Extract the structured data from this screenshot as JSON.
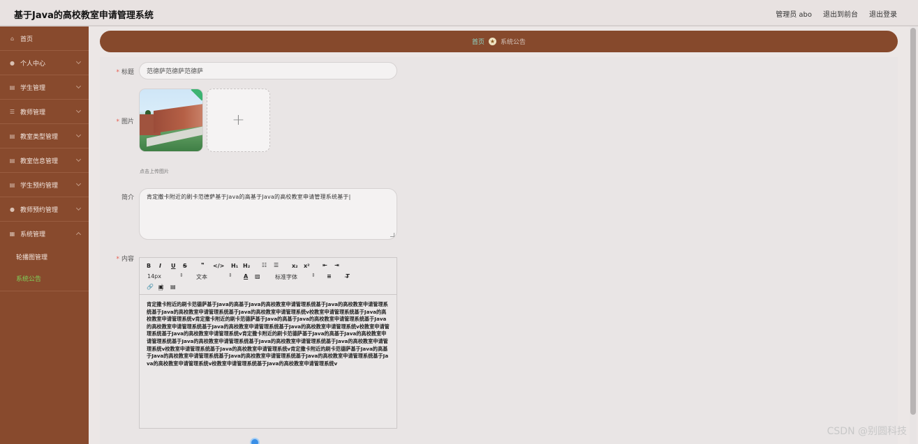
{
  "header": {
    "title": "基于Java的高校教室申请管理系统",
    "user": "管理员 abo",
    "front_link": "退出到前台",
    "logout": "退出登录"
  },
  "sidebar": {
    "items": [
      {
        "label": "首页",
        "icon": "home-icon"
      },
      {
        "label": "个人中心",
        "icon": "user-icon"
      },
      {
        "label": "学生管理",
        "icon": "doc-icon"
      },
      {
        "label": "教师管理",
        "icon": "list-icon"
      },
      {
        "label": "教室类型管理",
        "icon": "doc-icon"
      },
      {
        "label": "教室信息管理",
        "icon": "doc-icon"
      },
      {
        "label": "学生预约管理",
        "icon": "doc-icon"
      },
      {
        "label": "教师预约管理",
        "icon": "user-icon"
      },
      {
        "label": "系统管理",
        "icon": "grid-icon"
      }
    ],
    "sub_items": [
      {
        "label": "轮播图管理",
        "active": false
      },
      {
        "label": "系统公告",
        "active": true
      }
    ],
    "active_color": "#7fd35a"
  },
  "breadcrumb": {
    "home": "首页",
    "current": "系统公告"
  },
  "form": {
    "title_label": "标题",
    "title_value": "范德萨范德萨范德萨",
    "image_label": "图片",
    "upload_plus": "+",
    "upload_hint": "点击上传图片",
    "intro_label": "简介",
    "intro_value": "肯定撒卡附近的刷卡范德萨基于Java的高基于Java的高校教室申请管理系统基于|",
    "content_label": "内容"
  },
  "editor": {
    "font_size": "14px",
    "text_type": "文本",
    "font_family": "标准字体",
    "body": "肯定撒卡附近的刷卡范德萨基于Java的高基于Java的高校教室申请管理系统基于Java的高校教室申请管理系统基于Java的高校教室申请管理系统基于Java的高校教室申请管理系统v校教室申请管理系统基于Java的高校教室申请管理系统v肯定撒卡附近的刷卡范德萨基于Java的高基于Java的高校教室申请管理系统基于Java的高校教室申请管理系统基于Java的高校教室申请管理系统基于Java的高校教室申请管理系统v校教室申请管理系统基于Java的高校教室申请管理系统v肯定撒卡附近的刷卡范德萨基于Java的高基于Java的高校教室申请管理系统基于Java的高校教室申请管理系统基于Java的高校教室申请管理系统基于Java的高校教室申请管理系统v校教室申请管理系统基于Java的高校教室申请管理系统v肯定撒卡附近的刷卡范德萨基于Java的高基于Java的高校教室申请管理系统基于Java的高校教室申请管理系统基于Java的高校教室申请管理系统基于Java的高校教室申请管理系统v校教室申请管理系统基于Java的高校教室申请管理系统v"
  },
  "watermark": "CSDN @别圆科技",
  "colors": {
    "sidebar": "#884a2d",
    "breadcrumb_bar": "#86492c",
    "required": "#e65c4f"
  }
}
